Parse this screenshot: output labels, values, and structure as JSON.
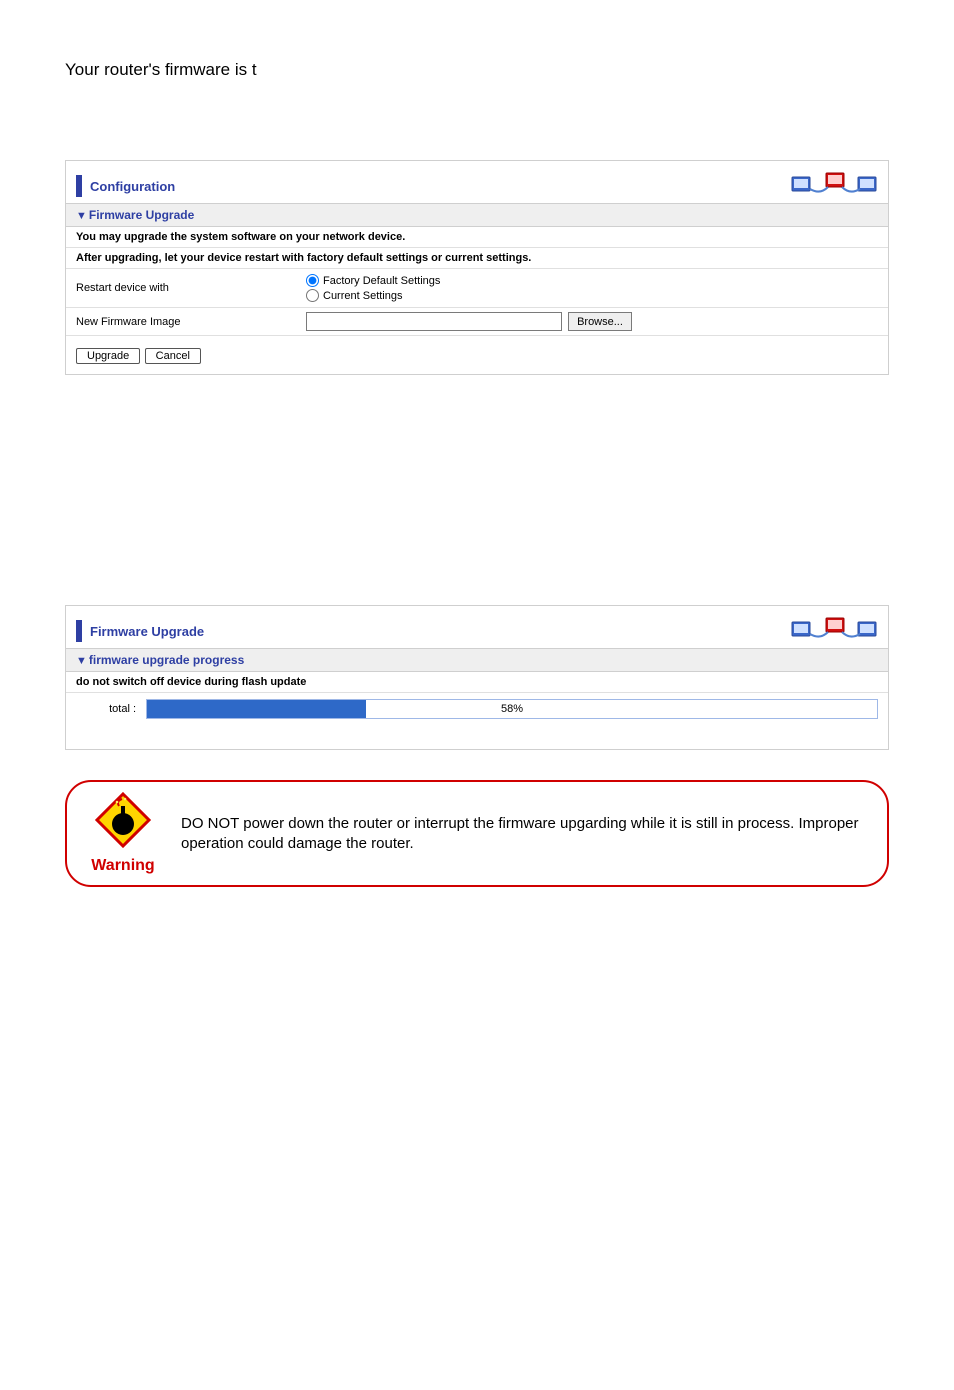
{
  "intro": "Your router's firmware is t",
  "panel1": {
    "title": "Configuration",
    "section_label": "Firmware Upgrade",
    "desc1": "You may upgrade the system software on your network device.",
    "desc2": "After upgrading, let your device restart with factory default settings or current settings.",
    "row_restart_label": "Restart device with",
    "radio_factory": "Factory Default Settings",
    "radio_current": "Current Settings",
    "row_image_label": "New Firmware Image",
    "browse_btn": "Browse...",
    "upgrade_btn": "Upgrade",
    "cancel_btn": "Cancel"
  },
  "panel2": {
    "title": "Firmware Upgrade",
    "section_label": "firmware upgrade progress",
    "desc": "do not switch off device during flash update",
    "progress_label": "total :",
    "progress_pct_text": "58%"
  },
  "warning": {
    "label": "Warning",
    "text": "DO NOT power down the router or interrupt the firmware upgarding while it is still in process. Improper operation could damage the router."
  },
  "chart_data": {
    "type": "bar",
    "title": "firmware upgrade progress",
    "categories": [
      "total"
    ],
    "values": [
      58
    ],
    "xlabel": "",
    "ylabel": "percent",
    "ylim": [
      0,
      100
    ]
  }
}
